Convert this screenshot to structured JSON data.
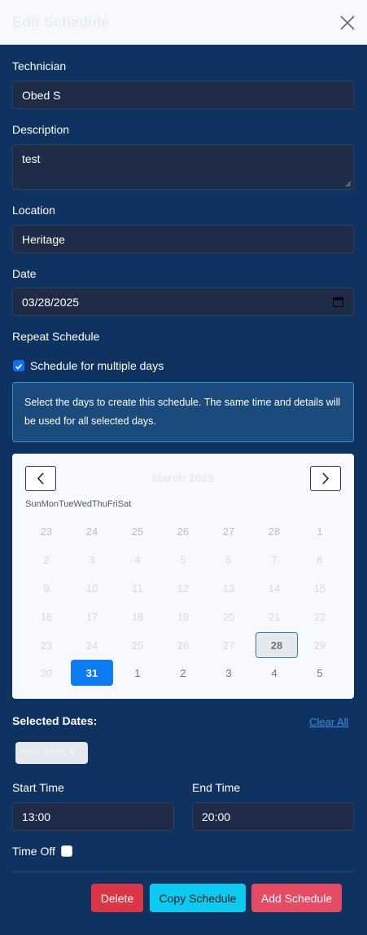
{
  "header": {
    "title": "Edit Schedule",
    "close_icon": "close-icon"
  },
  "technician": {
    "label": "Technician",
    "value": "Obed S"
  },
  "description": {
    "label": "Description",
    "value": "test"
  },
  "location": {
    "label": "Location",
    "value": "Heritage"
  },
  "date": {
    "label": "Date",
    "value": "03/28/2025",
    "icon": "calendar-icon"
  },
  "repeat": {
    "label": "Repeat Schedule",
    "multi_label": "Schedule for multiple days",
    "multi_checked": true,
    "info": "Select the days to create this schedule. The same time and details will be used for all selected days."
  },
  "calendar": {
    "month": "March 2025",
    "weekdays": [
      "Sun",
      "Mon",
      "Tue",
      "Wed",
      "Thu",
      "Fri",
      "Sat"
    ],
    "weeks": [
      [
        "23",
        "24",
        "25",
        "26",
        "27",
        "28",
        "1"
      ],
      [
        "2",
        "3",
        "4",
        "5",
        "6",
        "7",
        "8"
      ],
      [
        "9",
        "10",
        "11",
        "12",
        "13",
        "14",
        "15"
      ],
      [
        "16",
        "17",
        "18",
        "19",
        "20",
        "21",
        "22"
      ],
      [
        "23",
        "24",
        "25",
        "26",
        "27",
        "28",
        "29"
      ],
      [
        "30",
        "31",
        "1",
        "2",
        "3",
        "4",
        "5"
      ]
    ],
    "today": "28",
    "selected": "31"
  },
  "selected_dates": {
    "label": "Selected Dates:",
    "clear_all": "Clear All",
    "chips": [
      {
        "label": "Mon, 03/31",
        "remove": "×"
      }
    ]
  },
  "start_time": {
    "label": "Start Time",
    "value": "13:00"
  },
  "end_time": {
    "label": "End Time",
    "value": "20:00"
  },
  "time_off": {
    "label": "Time Off",
    "checked": false
  },
  "actions": {
    "delete": "Delete",
    "copy": "Copy Schedule",
    "add": "Add Schedule"
  },
  "colors": {
    "background": "#0e3360",
    "primary": "#0d6efd",
    "danger": "#dc3545",
    "info": "#0dcaf0",
    "add": "#e54b63"
  }
}
